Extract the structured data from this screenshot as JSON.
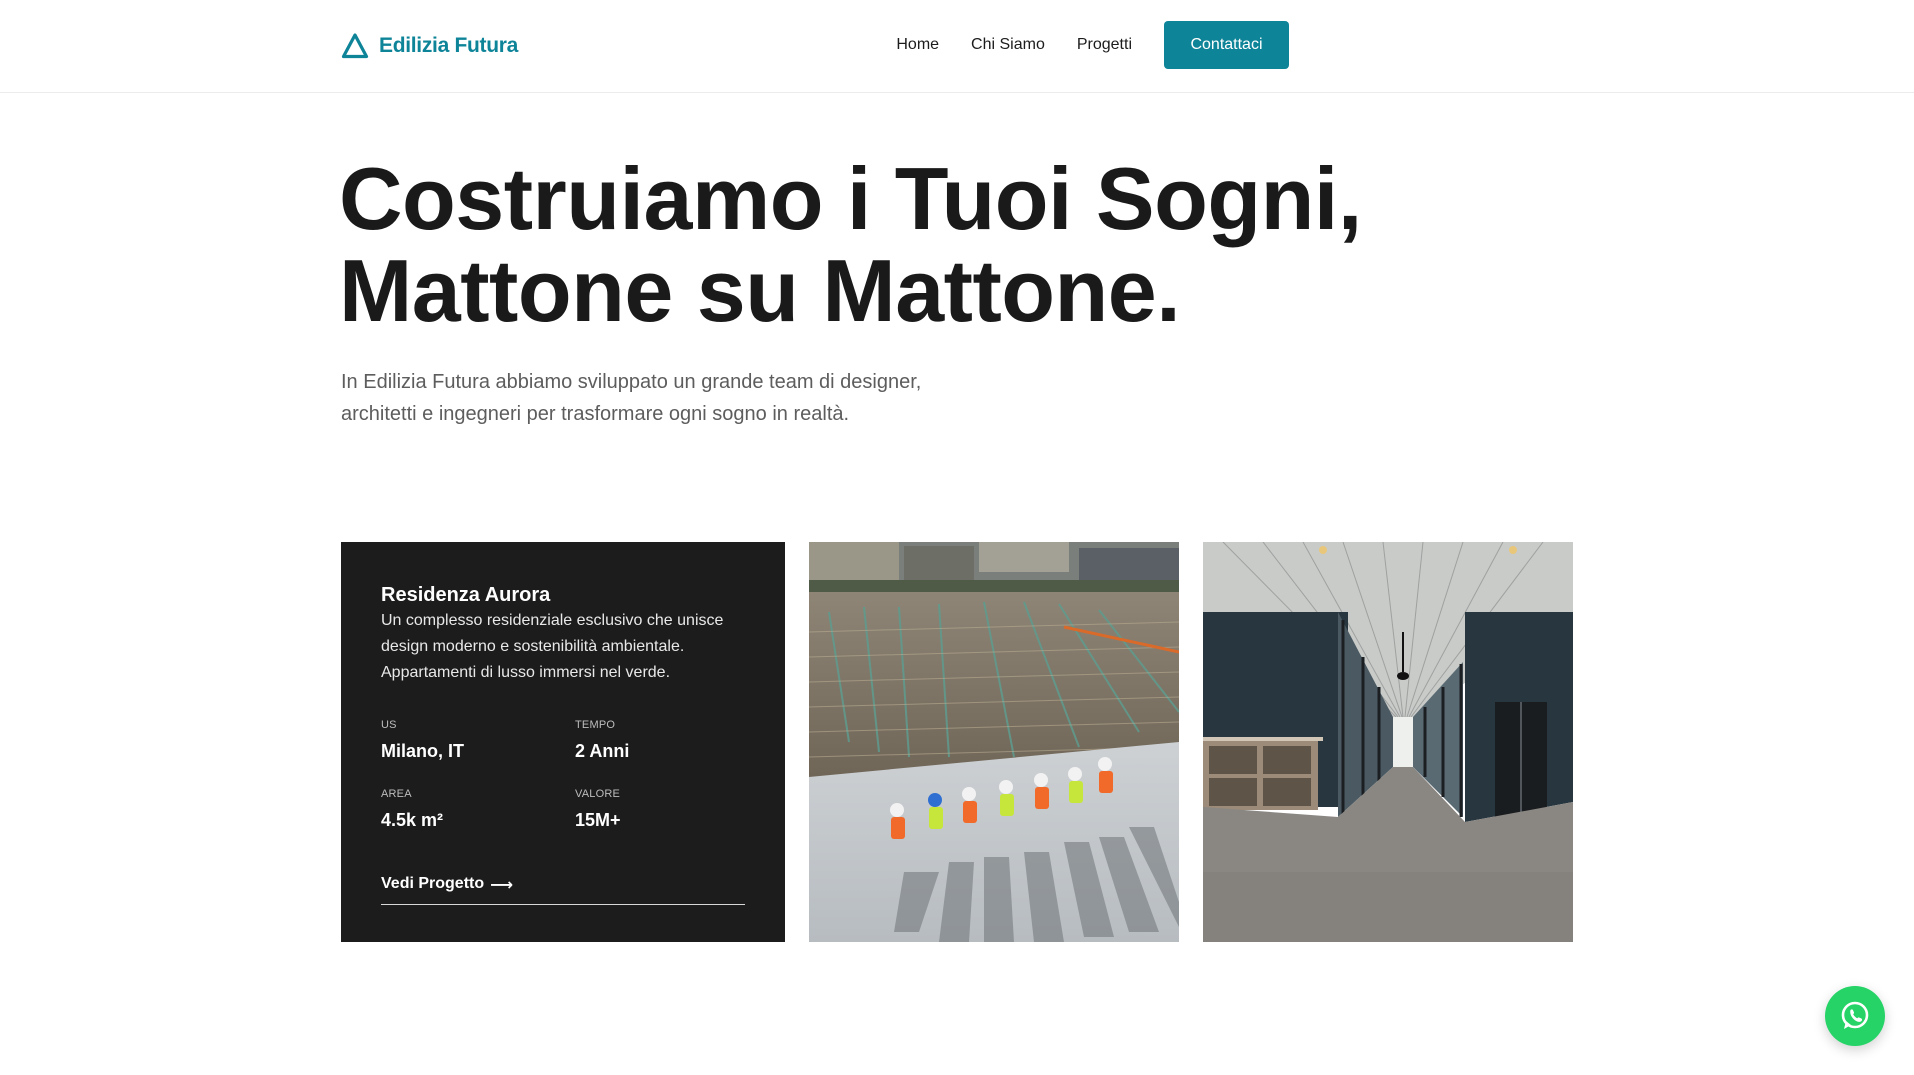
{
  "brand": {
    "name": "Edilizia Futura",
    "accent": "#0e8499"
  },
  "nav": {
    "links": [
      "Home",
      "Chi Siamo",
      "Progetti"
    ],
    "cta": "Contattaci"
  },
  "hero": {
    "title_lines": [
      "Costruiamo i Tuoi Sogni,",
      "Mattone su Mattone."
    ],
    "subtitle_lines": [
      "In Edilizia Futura abbiamo sviluppato un grande team di designer,",
      "architetti e ingegneri per trasformare ogni sogno in realtà."
    ]
  },
  "project": {
    "title": "Residenza Aurora",
    "description_lines": [
      "Un complesso residenziale esclusivo che unisce",
      "design moderno e sostenibilità ambientale.",
      "Appartamenti di lusso immersi nel verde."
    ],
    "stats": [
      {
        "label": "US",
        "value": "Milano, IT"
      },
      {
        "label": "TEMPO",
        "value": "2 Anni"
      },
      {
        "label": "AREA",
        "value": "4.5k m²"
      },
      {
        "label": "VALORE",
        "value": "15M+"
      }
    ],
    "link": "Vedi Progetto",
    "link_arrow": "⟶"
  },
  "images": [
    {
      "name": "construction-site-photo"
    },
    {
      "name": "office-corridor-photo"
    }
  ],
  "whatsapp": {
    "icon": "whatsapp-icon",
    "color": "#25d366"
  }
}
